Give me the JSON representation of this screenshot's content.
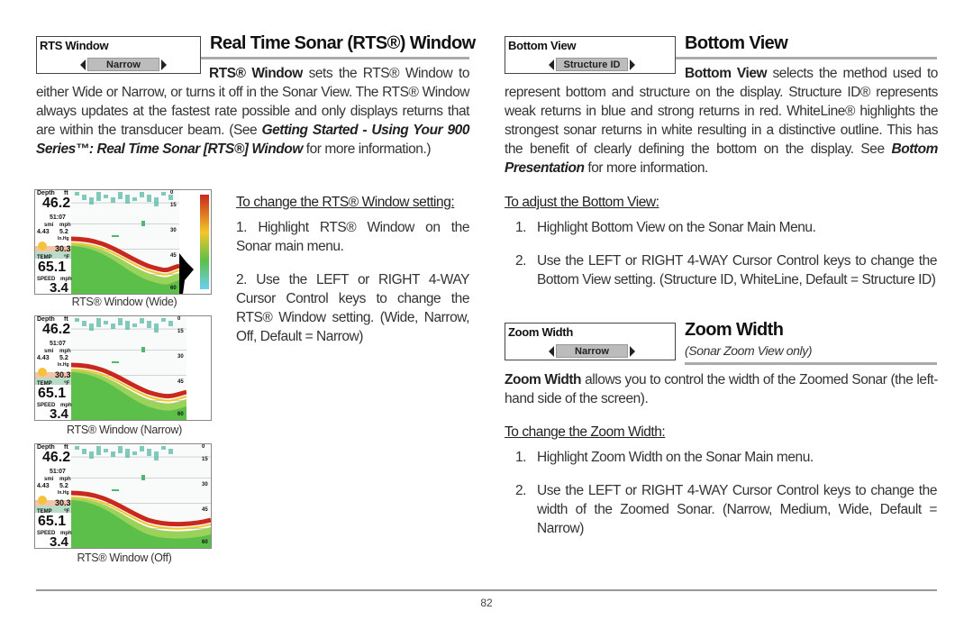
{
  "left": {
    "menu": {
      "title": "RTS Window",
      "value": "Narrow"
    },
    "heading": "Real Time Sonar (RTS®) Window",
    "intro_bold": "RTS® Window",
    "intro_rest": " sets the RTS® Window to either Wide or Narrow, or turns it off in the Sonar View. The RTS® Window always updates at the fastest rate possible and only displays returns that are within the transducer beam. (See ",
    "intro_link": "Getting Started - Using Your 900 Series™: Real Time Sonar [RTS®] Window",
    "intro_end": " for more information.)",
    "subheading": "To change the RTS® Window setting:",
    "steps": [
      {
        "n": "1.",
        "text": "Highlight RTS® Window on the Sonar main menu."
      },
      {
        "n": "2.",
        "text": "Use the LEFT or RIGHT 4-WAY Cursor Control keys to change the RTS® Window setting. (Wide, Narrow, Off, Default = Narrow)"
      }
    ],
    "captions": [
      "RTS® Window (Wide)",
      "RTS® Window (Narrow)",
      "RTS® Window (Off)"
    ]
  },
  "sonar": {
    "depth_label": "Depth",
    "depth_unit": "ft",
    "depth": "46.2",
    "time": "51:07",
    "dist_unit": "smi",
    "speed_unit": "mph",
    "dist": "4.43",
    "spd": "5.2",
    "pressure_unit": "In.Hg",
    "pressure": "30.3",
    "temp_label": "TEMP",
    "temp_unit": "°F",
    "temp": "65.1",
    "speed_label": "SPEED",
    "speed": "3.4",
    "scale": [
      "0",
      "15",
      "30",
      "45",
      "60"
    ]
  },
  "right": {
    "bottom": {
      "menu": {
        "title": "Bottom View",
        "value": "Structure ID"
      },
      "heading": "Bottom View",
      "intro_bold": "Bottom View",
      "intro_rest": " selects the method used to represent bottom and structure on the display. Structure ID® represents weak returns in blue and strong returns in red. WhiteLine® highlights the strongest sonar returns in white resulting in a distinctive outline. This has the benefit of clearly defining the bottom on the display. See ",
      "intro_link": "Bottom Presentation",
      "intro_end": " for more information.",
      "subheading": "To adjust the Bottom View:",
      "steps": [
        {
          "n": "1.",
          "text": "Highlight Bottom View on the Sonar Main Menu."
        },
        {
          "n": "2.",
          "text": "Use the LEFT or RIGHT 4-WAY Cursor Control keys to change the Bottom View setting. (Structure ID, WhiteLine, Default = Structure ID)"
        }
      ]
    },
    "zoom": {
      "menu": {
        "title": "Zoom Width",
        "value": "Narrow"
      },
      "heading": "Zoom Width",
      "note": "(Sonar Zoom View only)",
      "intro_bold": "Zoom Width",
      "intro_rest": " allows you to control the width of the Zoomed Sonar (the left-hand side of the screen).",
      "subheading": "To change the Zoom Width:",
      "steps": [
        {
          "n": "1.",
          "text": "Highlight Zoom Width on the Sonar Main menu."
        },
        {
          "n": "2.",
          "text": "Use the LEFT or RIGHT 4-WAY Cursor Control keys to change the width of the Zoomed Sonar. (Narrow, Medium, Wide, Default = Narrow)"
        }
      ]
    }
  },
  "page_number": "82"
}
